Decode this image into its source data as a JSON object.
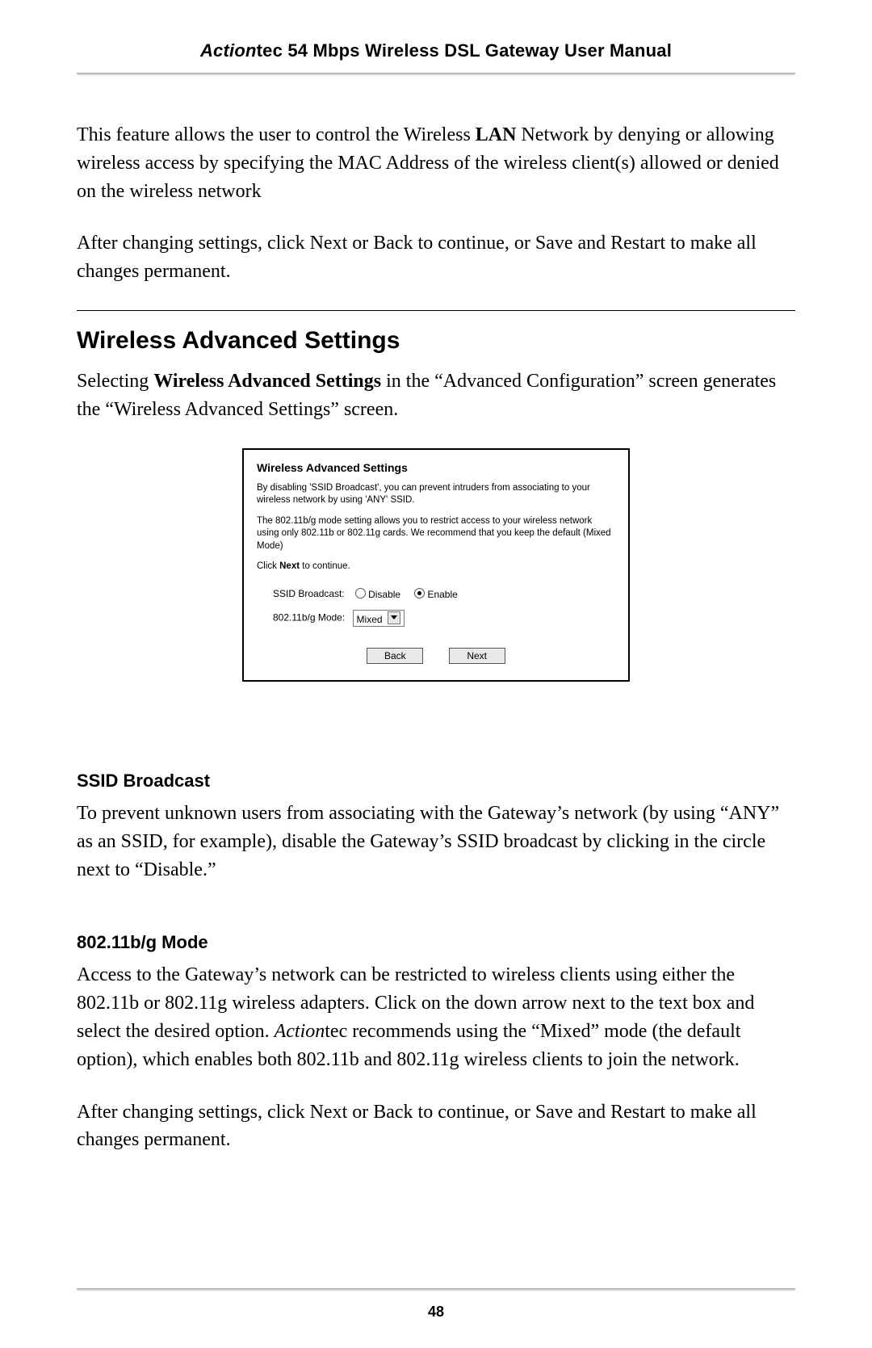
{
  "header": {
    "brand_italic": "Action",
    "brand_rest": "tec 54 Mbps Wireless DSL Gateway User Manual"
  },
  "intro": {
    "p1_pre": "This feature allows the user to control the Wireless ",
    "p1_bold": "LAN",
    "p1_mid": " Network by denying or allowing wireless access by specifying the ",
    "p1_mac": "MAC",
    "p1_post": " Address of the wireless client(s) allowed or denied on the wireless network",
    "p2": "After changing settings, click Next or Back to continue, or Save and Restart to make all changes permanent."
  },
  "section": {
    "title": "Wireless Advanced Settings",
    "p_pre": "Selecting ",
    "p_bold": "Wireless Advanced Settings",
    "p_post": " in the “Advanced Configuration” screen generates the “Wireless Advanced Settings” screen."
  },
  "ui": {
    "title": "Wireless Advanced Settings",
    "help1": "By disabling 'SSID Broadcast', you can prevent intruders from associating to your wireless network by using 'ANY' SSID.",
    "help2": "The 802.11b/g mode setting allows you to restrict access to your wireless network using only 802.11b or 802.11g cards. We recommend that you keep the default (Mixed Mode)",
    "help3_pre": "Click ",
    "help3_bold": "Next",
    "help3_post": " to continue.",
    "ssid_label": "SSID Broadcast:",
    "ssid_disable": "Disable",
    "ssid_enable": "Enable",
    "mode_label": "802.11b/g Mode:",
    "mode_value": "Mixed",
    "btn_back": "Back",
    "btn_next": "Next"
  },
  "ssid_section": {
    "title": "SSID Broadcast",
    "p_a": "To prevent unknown users from associating with the Gateway’s network (by using “",
    "p_any": "ANY",
    "p_b": "” as an ",
    "p_ssid1": "SSID",
    "p_c": ", for example), disable the Gateway’s ",
    "p_ssid2": "SSID",
    "p_d": " broadcast by clicking in the circle next to “Disable.”"
  },
  "mode_section": {
    "title": "802.11b/g Mode",
    "p1_a": "Access to the Gateway’s network can be restricted to wireless clients using either the ",
    "p1_b": "802.11",
    "p1_c": "b or ",
    "p1_d": "802.11",
    "p1_e": "g wireless adapters. Click on the down arrow next to the text box and select the desired option. ",
    "p1_brand": "Action",
    "p1_f": "tec recommends using the “Mixed” mode (the default option), which enables both ",
    "p1_g": "802.11",
    "p1_h": "b and ",
    "p1_i": "802.11",
    "p1_j": "g wireless clients to join the network.",
    "p2": "After changing settings, click Next or Back to continue, or Save and Restart to make all changes permanent."
  },
  "page_number": "48"
}
